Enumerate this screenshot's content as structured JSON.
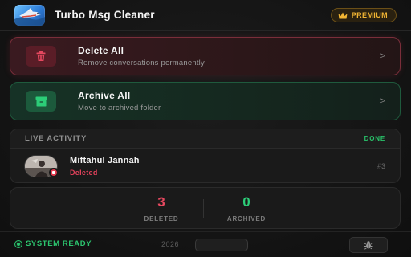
{
  "header": {
    "app_icon": "app-logo-icon",
    "title": "Turbo Msg Cleaner",
    "premium_label": "PREMIUM",
    "premium_icon": "crown-icon"
  },
  "actions": [
    {
      "title": "Delete All",
      "subtitle": "Remove conversations permanently",
      "icon": "trash-icon",
      "chevron": ">",
      "accent": "#e0415a"
    },
    {
      "title": "Archive All",
      "subtitle": "Move to archived folder",
      "icon": "archive-icon",
      "chevron": ">",
      "accent": "#2ccd78"
    }
  ],
  "activity": {
    "label": "LIVE ACTIVITY",
    "status": "DONE",
    "item": {
      "name": "Miftahul Jannah",
      "status": "Deleted",
      "index": "#3"
    }
  },
  "stats": {
    "deleted_value": "3",
    "deleted_label": "DELETED",
    "archived_value": "0",
    "archived_label": "ARCHIVED"
  },
  "footer": {
    "system_status": "SYSTEM READY",
    "year": "2026",
    "bug_icon": "bug-icon"
  }
}
